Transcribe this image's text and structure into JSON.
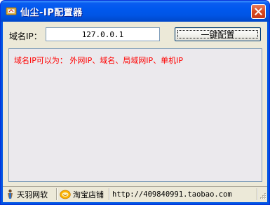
{
  "window": {
    "title": "仙尘-IP配置器"
  },
  "form": {
    "ip_label": "域名IP：",
    "ip_value": "127.0.0.1",
    "config_button": "一键配置"
  },
  "output": {
    "message": "域名IP可以为： 外网IP、域名、局域网IP、单机IP"
  },
  "statusbar": {
    "author": "天羽网软",
    "shop": "淘宝店铺",
    "url": "http://409840991.taobao.com"
  },
  "icons": {
    "app": "app-icon",
    "close": "close-icon",
    "author": "figure-icon",
    "shop": "taobao-icon"
  },
  "colors": {
    "titlebar": "#0058ee",
    "close_button": "#d7481f",
    "output_text": "#ff0000",
    "client_bg": "#ece9d8"
  }
}
